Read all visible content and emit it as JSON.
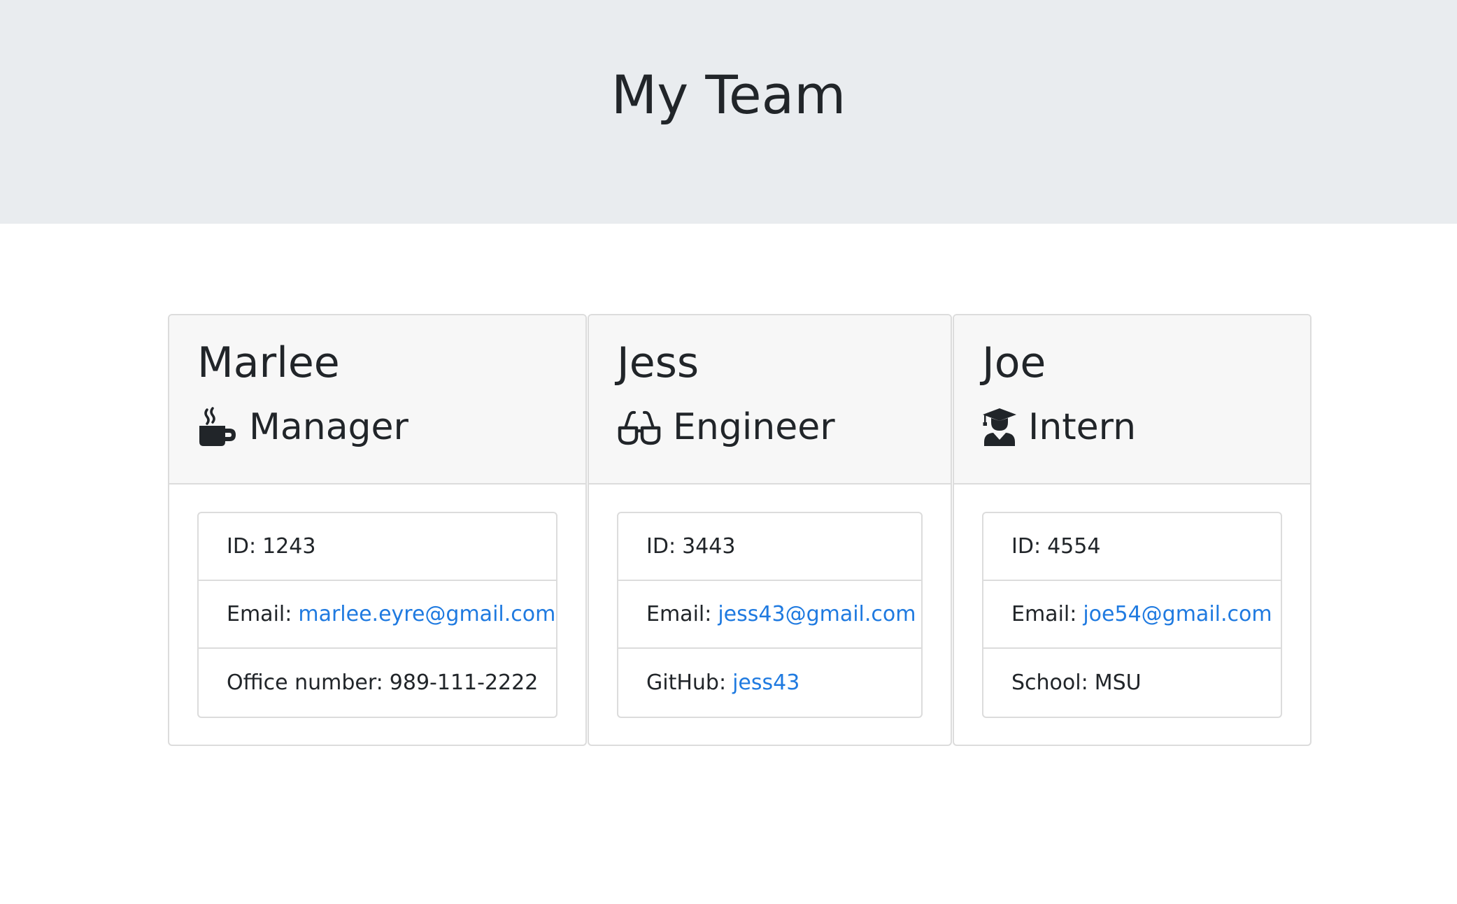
{
  "header": {
    "title": "My Team"
  },
  "employees": [
    {
      "name": "Marlee",
      "role": "Manager",
      "icon": "coffee-icon",
      "id_label": "ID:",
      "id": "1243",
      "email_label": "Email:",
      "email": "marlee.eyre@gmail.com",
      "extra_label": "Office number:",
      "extra_value": "989-111-2222"
    },
    {
      "name": "Jess",
      "role": "Engineer",
      "icon": "glasses-icon",
      "id_label": "ID:",
      "id": "3443",
      "email_label": "Email:",
      "email": "jess43@gmail.com",
      "extra_label": "GitHub:",
      "extra_value": "jess43"
    },
    {
      "name": "Joe",
      "role": "Intern",
      "icon": "graduate-icon",
      "id_label": "ID:",
      "id": "4554",
      "email_label": "Email:",
      "email": "joe54@gmail.com",
      "extra_label": "School:",
      "extra_value": "MSU"
    }
  ],
  "colors": {
    "header_bg": "#e9ecef",
    "card_header_bg": "#f7f7f7",
    "link": "#1f7ae0",
    "text": "#212529"
  }
}
